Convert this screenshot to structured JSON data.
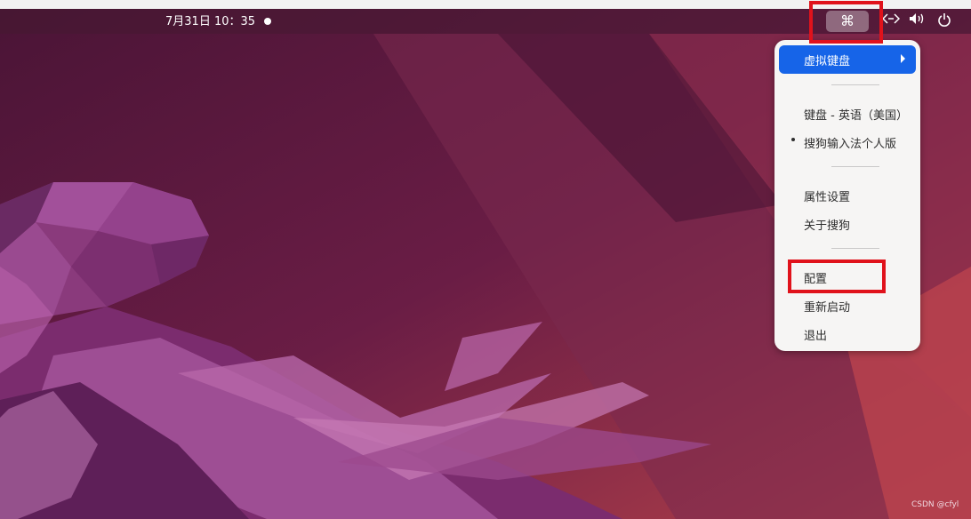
{
  "topbar": {
    "datetime": "7月31日  10：35",
    "ime_icon": "⌘",
    "tray": {
      "network_icon": "network-icon",
      "volume_icon": "volume-icon",
      "power_icon": "power-icon"
    }
  },
  "menu": {
    "submenu_label": "虚拟键盘",
    "items": [
      "键盘 - 英语（美国）",
      "搜狗输入法个人版",
      "属性设置",
      "关于搜狗",
      "配置",
      "重新启动",
      "退出"
    ]
  },
  "watermark": "CSDN @cfyl",
  "colors": {
    "accent": "#1664e8",
    "highlight": "#e0121b",
    "menu_bg": "#f6f5f4"
  }
}
